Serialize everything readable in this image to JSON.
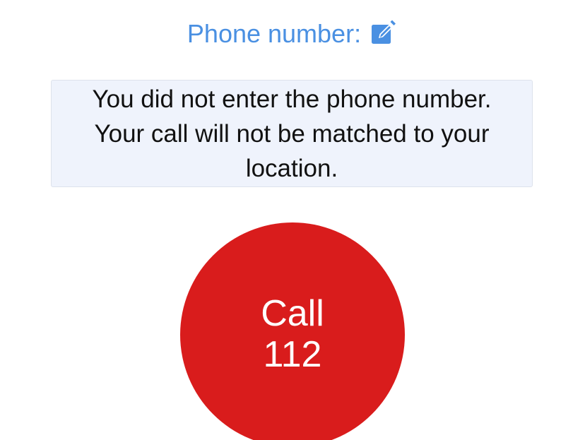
{
  "phone": {
    "label": "Phone number:",
    "edit_icon": "edit-pencil-square-icon",
    "accent_color": "#4a90e2"
  },
  "notice": {
    "message": "You did not enter the phone number. Your call will not be matched to your location.",
    "background_color": "#eff3fc"
  },
  "call_button": {
    "line1": "Call",
    "line2": "112",
    "color": "#d91c1c"
  }
}
